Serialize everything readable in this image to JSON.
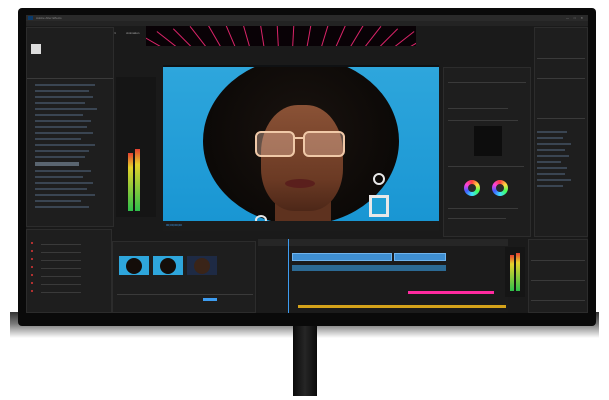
{
  "app": {
    "title": "Adobe After Effects",
    "window_controls": "— □ ✕"
  },
  "menu": [
    "File",
    "Edit",
    "Composition",
    "Layer",
    "Effect",
    "Animation",
    "View",
    "Window",
    "Help"
  ],
  "program_monitor": {
    "timecode": "00;00;00;00"
  },
  "colors": {
    "accent": "#3d9cf0",
    "sky": "#1f9fd8",
    "neon": "#ff2a7a",
    "clip_pink": "#ff2aa0",
    "clip_gold": "#d4a21a"
  },
  "icons": [
    "app-icon",
    "color-wheel-icon",
    "playhead-icon"
  ]
}
